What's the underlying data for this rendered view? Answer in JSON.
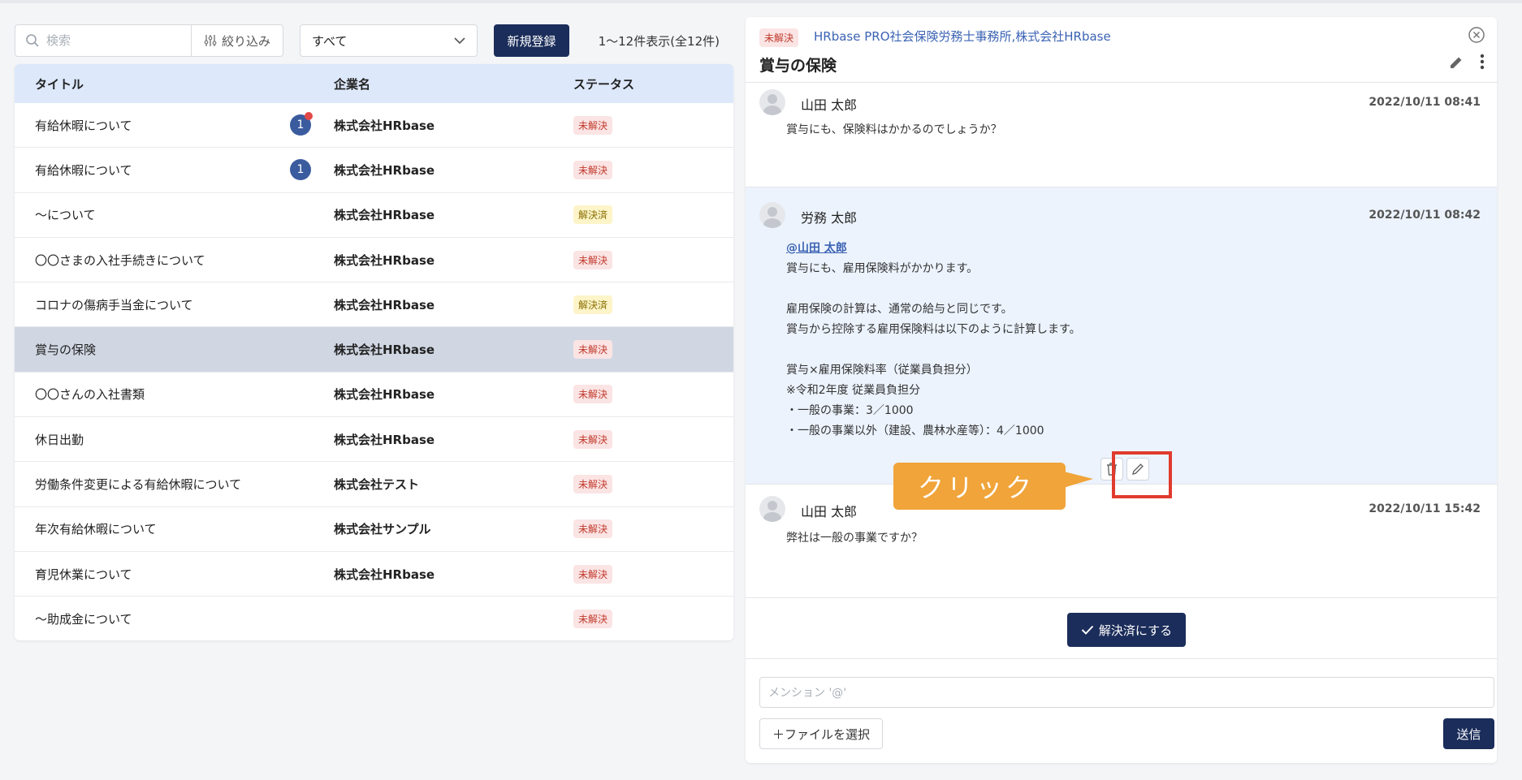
{
  "toolbar": {
    "search_placeholder": "検索",
    "filter_label": "絞り込み",
    "status_select": "すべて",
    "new_button": "新規登録",
    "count_text": "1～12件表示(全12件)"
  },
  "table": {
    "headers": {
      "title": "タイトル",
      "company": "企業名",
      "status": "ステータス"
    },
    "rows": [
      {
        "title": "有給休暇について",
        "company": "株式会社HRbase",
        "status": "未解決",
        "badge": "1"
      },
      {
        "title": "有給休暇について",
        "company": "株式会社HRbase",
        "status": "未解決",
        "badge": "1"
      },
      {
        "title": "～について",
        "company": "株式会社HRbase",
        "status": "解決済"
      },
      {
        "title": "〇〇さまの入社手続きについて",
        "company": "株式会社HRbase",
        "status": "未解決"
      },
      {
        "title": "コロナの傷病手当金について",
        "company": "株式会社HRbase",
        "status": "解決済"
      },
      {
        "title": "賞与の保険",
        "company": "株式会社HRbase",
        "status": "未解決"
      },
      {
        "title": "〇〇さんの入社書類",
        "company": "株式会社HRbase",
        "status": "未解決"
      },
      {
        "title": "休日出勤",
        "company": "株式会社HRbase",
        "status": "未解決"
      },
      {
        "title": "労働条件変更による有給休暇について",
        "company": "株式会社テスト",
        "status": "未解決"
      },
      {
        "title": "年次有給休暇について",
        "company": "株式会社サンプル",
        "status": "未解決"
      },
      {
        "title": "育児休業について",
        "company": "株式会社HRbase",
        "status": "未解決"
      },
      {
        "title": "～助成金について",
        "company": "",
        "status": "未解決"
      }
    ]
  },
  "panel": {
    "status": "未解決",
    "orgs": "HRbase PRO社会保険労務士事務所,株式会社HRbase",
    "title": "賞与の保険",
    "messages": [
      {
        "name": "山田 太郎",
        "time": "2022/10/11 08:41",
        "lines": [
          "賞与にも、保険料はかかるのでしょうか？"
        ]
      },
      {
        "name": "労務 太郎",
        "time": "2022/10/11 08:42",
        "mention": "@山田 太郎",
        "lines": [
          "賞与にも、雇用保険料がかかります。",
          "",
          "雇用保険の計算は、通常の給与と同じです。",
          "賞与から控除する雇用保険料は以下のように計算します。",
          "",
          "賞与×雇用保険料率（従業員負担分）",
          "※令和2年度 従業員負担分",
          "・一般の事業：3／1000",
          "・一般の事業以外（建設、農林水産等）：4／1000"
        ]
      },
      {
        "name": "山田 太郎",
        "time": "2022/10/11 15:42",
        "lines": [
          "弊社は一般の事業ですか？"
        ]
      }
    ],
    "callout": "クリック",
    "resolve_button": "解決済にする",
    "mention_placeholder": "メンション '@'",
    "file_button": "＋ファイルを選択",
    "send_button": "送信"
  }
}
